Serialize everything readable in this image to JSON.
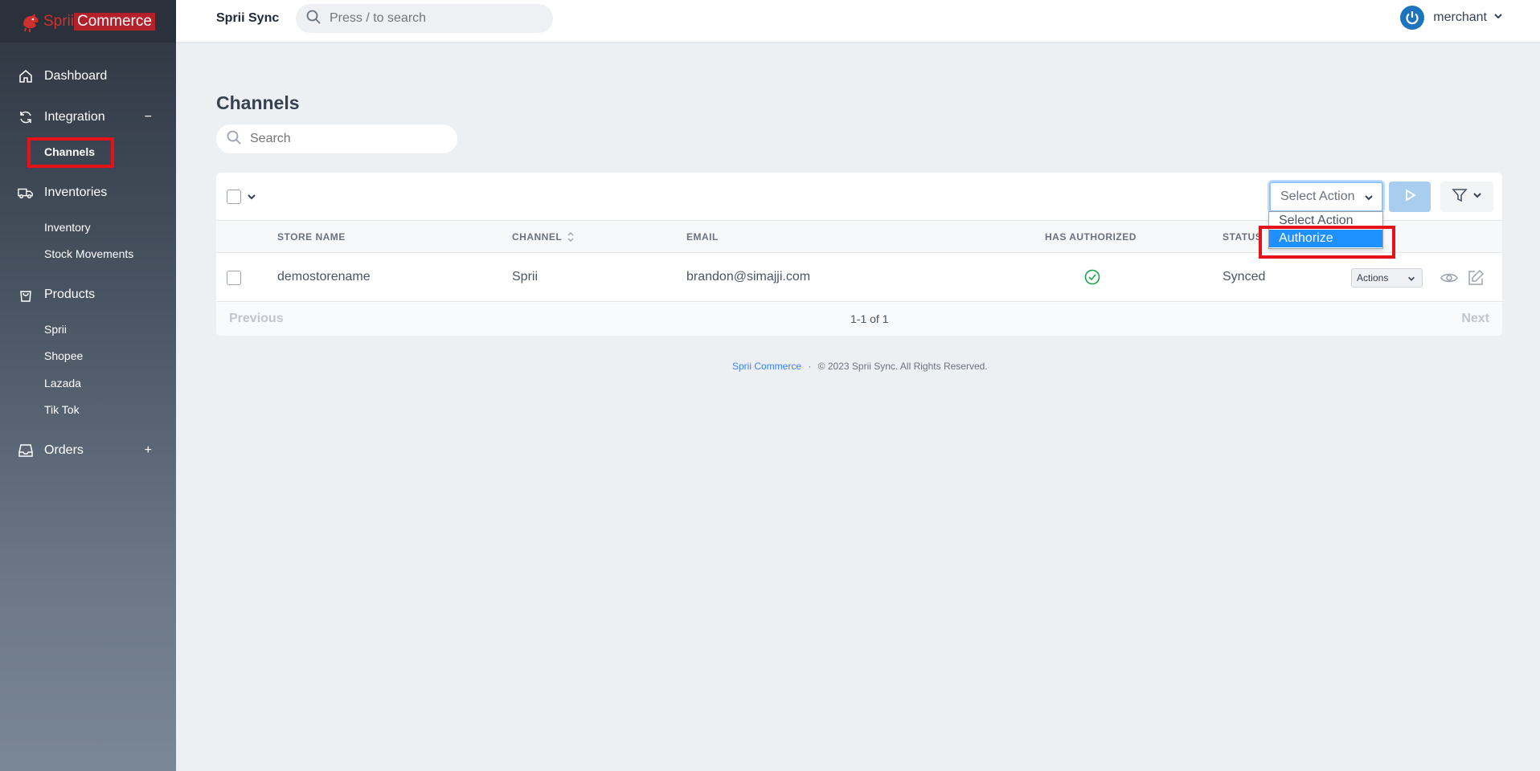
{
  "brand": {
    "name_part1": "Sprii",
    "name_part2": "Commerce"
  },
  "topbar": {
    "app_title": "Sprii Sync",
    "search_placeholder": "Press / to search",
    "username": "merchant"
  },
  "sidebar": {
    "dashboard": "Dashboard",
    "integration": {
      "label": "Integration",
      "toggle": "−",
      "children": [
        "Channels"
      ]
    },
    "inventories": {
      "label": "Inventories",
      "children": [
        "Inventory",
        "Stock Movements"
      ]
    },
    "products": {
      "label": "Products",
      "children": [
        "Sprii",
        "Shopee",
        "Lazada",
        "Tik Tok"
      ]
    },
    "orders": {
      "label": "Orders",
      "toggle": "+"
    }
  },
  "main": {
    "title": "Channels",
    "search_placeholder": "Search",
    "toolbar": {
      "select_action": "Select Action"
    },
    "dropdown_options": [
      "Select Action",
      "Authorize"
    ],
    "columns": [
      "STORE NAME",
      "CHANNEL",
      "EMAIL",
      "HAS AUTHORIZED",
      "STATUS"
    ],
    "rows": [
      {
        "store_name": "demostorename",
        "channel": "Sprii",
        "email": "brandon@simajji.com",
        "status": "Synced",
        "actions": "Actions"
      }
    ],
    "pager": {
      "previous": "Previous",
      "count": "1-1 of 1",
      "next": "Next"
    }
  },
  "footer": {
    "link": "Sprii Commerce",
    "sep": "·",
    "copyright": "© 2023 Sprii Sync. All Rights Reserved."
  },
  "colors": {
    "accent": "#1e90ff",
    "highlight": "#e6121a",
    "success": "#16a34a"
  }
}
